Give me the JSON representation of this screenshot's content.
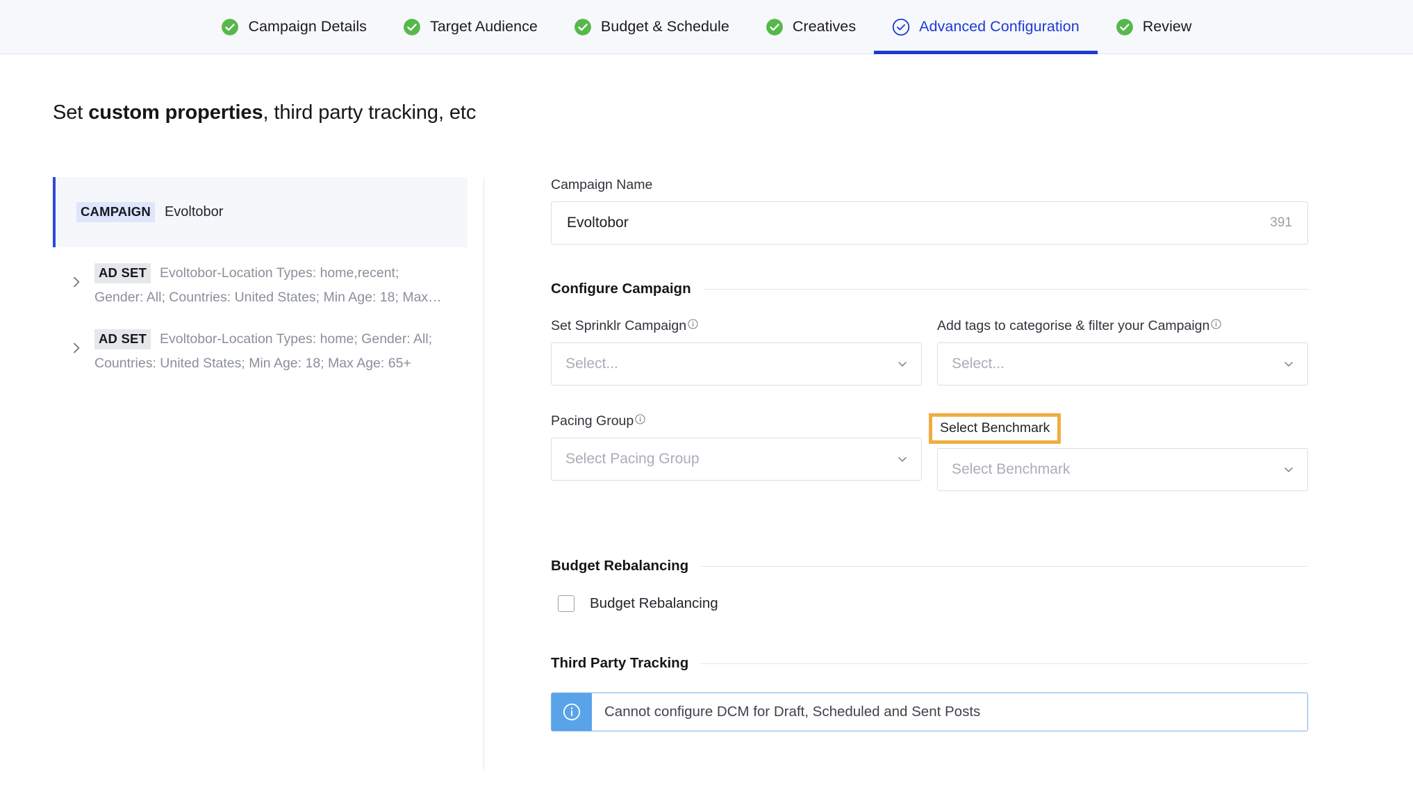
{
  "wizard": {
    "tabs": [
      {
        "label": "Campaign Details",
        "state": "complete",
        "icon": "check-circle-filled-icon"
      },
      {
        "label": "Target Audience",
        "state": "complete",
        "icon": "check-circle-filled-icon"
      },
      {
        "label": "Budget & Schedule",
        "state": "complete",
        "icon": "check-circle-filled-icon"
      },
      {
        "label": "Creatives",
        "state": "complete",
        "icon": "check-circle-filled-icon"
      },
      {
        "label": "Advanced Configuration",
        "state": "active",
        "icon": "check-circle-outline-icon"
      },
      {
        "label": "Review",
        "state": "complete",
        "icon": "check-circle-filled-icon"
      }
    ],
    "active_index": 4,
    "complete_color": "#56b84b",
    "active_color": "#1d39d6"
  },
  "page": {
    "title_prefix": "Set ",
    "title_bold": "custom properties",
    "title_suffix": ", third party tracking, etc"
  },
  "tree": {
    "campaign": {
      "chip": "CAMPAIGN",
      "name": "Evoltobor",
      "selected": true
    },
    "ad_sets": [
      {
        "chip": "AD SET",
        "line1": "Evoltobor-Location Types: home,recent;",
        "line2": "Gender: All; Countries: United States; Min Age: 18; Max…",
        "expand_icon": "chevron-right-icon"
      },
      {
        "chip": "AD SET",
        "line1": "Evoltobor-Location Types: home; Gender: All;",
        "line2": "Countries: United States; Min Age: 18; Max Age: 65+",
        "expand_icon": "chevron-right-icon"
      }
    ]
  },
  "form": {
    "campaign_name": {
      "label": "Campaign Name",
      "value": "Evoltobor",
      "counter": "391"
    },
    "configure_campaign": {
      "heading": "Configure Campaign",
      "sprinklr_campaign": {
        "label": "Set Sprinklr Campaign",
        "placeholder": "Select...",
        "value": "",
        "info_icon": "info-circle-icon",
        "caret_icon": "chevron-down-icon"
      },
      "tags": {
        "label": "Add tags to categorise & filter your Campaign",
        "placeholder": "Select...",
        "value": "",
        "info_icon": "info-circle-icon",
        "caret_icon": "chevron-down-icon"
      },
      "pacing_group": {
        "label": "Pacing Group",
        "placeholder": "Select Pacing Group",
        "value": "",
        "info_icon": "info-circle-icon",
        "caret_icon": "chevron-down-icon"
      },
      "benchmark": {
        "label": "Select Benchmark",
        "placeholder": "Select Benchmark",
        "value": "",
        "highlighted": true,
        "highlight_color": "#f0ad3e",
        "caret_icon": "chevron-down-icon"
      }
    },
    "budget_rebalancing": {
      "heading": "Budget Rebalancing",
      "checkbox_label": "Budget Rebalancing",
      "checked": false
    },
    "third_party_tracking": {
      "heading": "Third Party Tracking",
      "banner_text": "Cannot configure DCM for Draft, Scheduled and Sent Posts",
      "banner_icon": "info-circle-icon",
      "banner_color": "#5aa3e8"
    }
  }
}
